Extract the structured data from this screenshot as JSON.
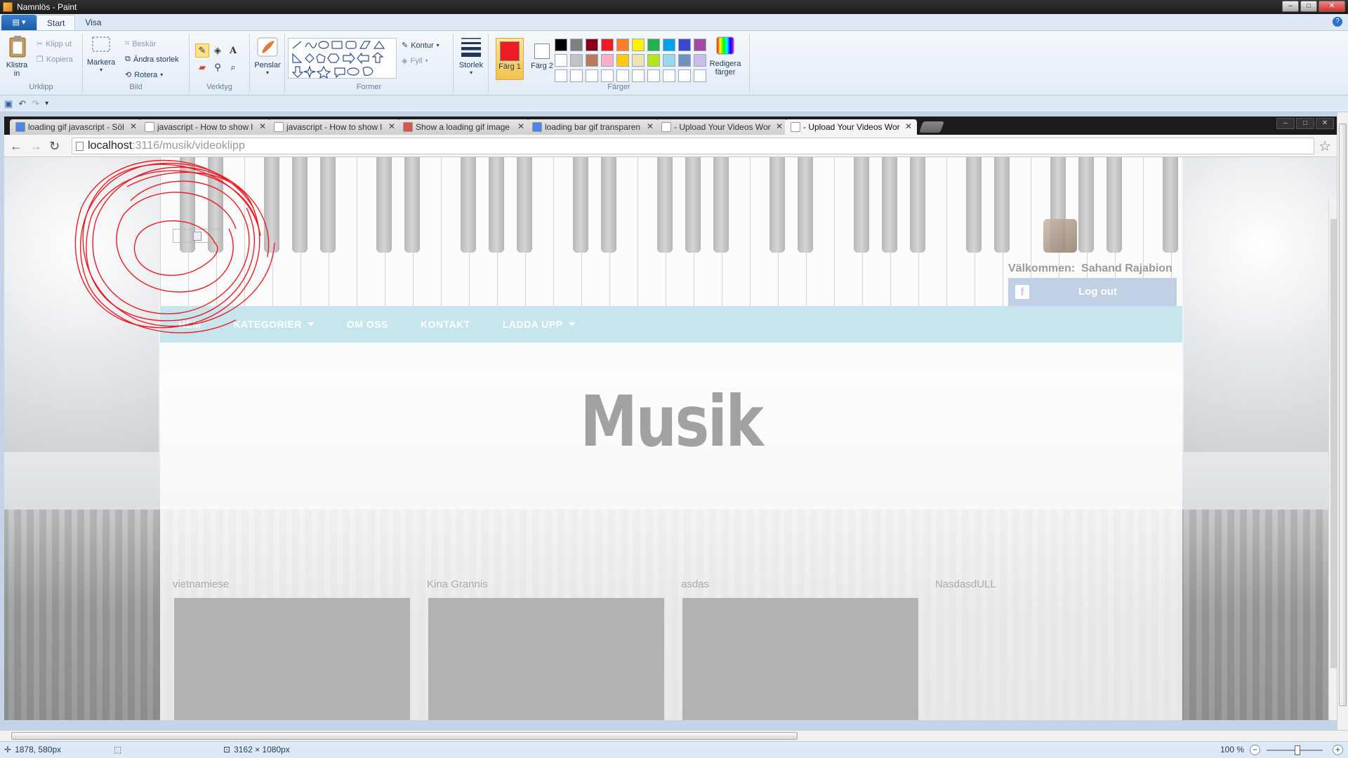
{
  "window": {
    "title": "Namnlös - Paint"
  },
  "ribbon_tabs": [
    "Start",
    "Visa"
  ],
  "ribbon": {
    "clipboard": {
      "group": "Urklipp",
      "paste": "Klistra in",
      "cut": "Klipp ut",
      "copy": "Kopiera"
    },
    "image": {
      "group": "Bild",
      "select": "Markera",
      "crop": "Beskär",
      "resize": "Ändra storlek",
      "rotate": "Rotera"
    },
    "tools": {
      "group": "Verktyg"
    },
    "brushes": "Penslar",
    "shapes": {
      "group": "Former",
      "outline": "Kontur",
      "fill": "Fyll"
    },
    "size": "Storlek",
    "colors": {
      "group": "Färger",
      "color1": "Färg 1",
      "color2": "Färg 2",
      "edit": "Redigera färger",
      "palette": [
        "#000000",
        "#7f7f7f",
        "#880015",
        "#ed1c24",
        "#ff7f27",
        "#fff200",
        "#22b14c",
        "#00a2e8",
        "#3f48cc",
        "#a349a4",
        "#ffffff",
        "#c3c3c3",
        "#b97a57",
        "#ffaec9",
        "#ffc90e",
        "#efe4b0",
        "#b5e61d",
        "#99d9ea",
        "#7092be",
        "#c8bfe7",
        "",
        "",
        "",
        "",
        "",
        "",
        "",
        "",
        "",
        ""
      ],
      "active_color": "#ed1c24"
    }
  },
  "browser": {
    "tabs": [
      {
        "title": "loading gif javascript - Söl",
        "favicon": "google"
      },
      {
        "title": "javascript - How to show l",
        "favicon": "page"
      },
      {
        "title": "javascript - How to show l",
        "favicon": "page"
      },
      {
        "title": "Show a loading gif image",
        "favicon": "eplus"
      },
      {
        "title": "loading bar gif transparen",
        "favicon": "google"
      },
      {
        "title": "- Upload Your Videos Wor",
        "favicon": "page"
      },
      {
        "title": "- Upload Your Videos Wor",
        "favicon": "page",
        "active": true
      }
    ],
    "url_host": "localhost",
    "url_rest": ":3116/musik/videoklipp"
  },
  "site": {
    "welcome_label": "Välkommen:",
    "user_name": "Sahand Rajabion",
    "logout": "Log out",
    "nav": [
      {
        "label": "HEM",
        "dropdown": false
      },
      {
        "label": "KATEGORIER",
        "dropdown": true
      },
      {
        "label": "OM OSS",
        "dropdown": false
      },
      {
        "label": "KONTAKT",
        "dropdown": false
      },
      {
        "label": "LADDA UPP",
        "dropdown": true
      }
    ],
    "page_title": "Musik",
    "videos": [
      "vietnamiese",
      "Kina Grannis",
      "asdas",
      "NasdasdULL"
    ]
  },
  "status": {
    "cursor_pos": "1878, 580px",
    "image_size": "3162 × 1080px",
    "zoom": "100 %"
  }
}
